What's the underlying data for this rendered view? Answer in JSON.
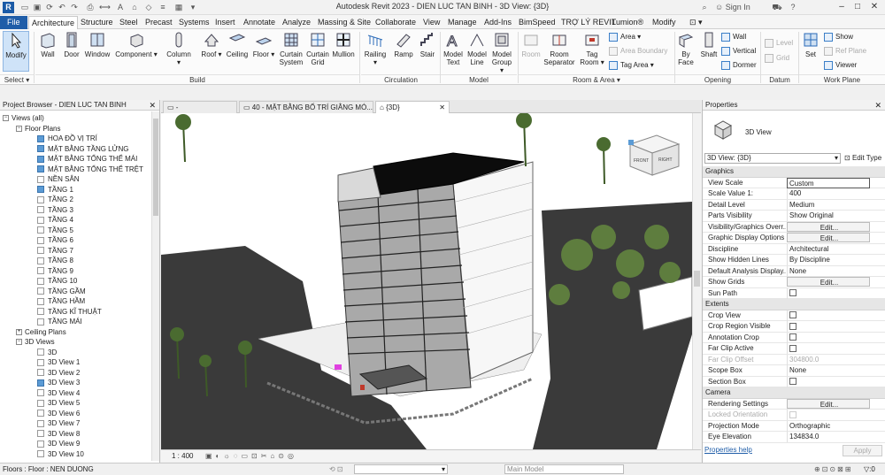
{
  "title_bar": {
    "title": "Autodesk Revit 2023 - DIEN LUC TAN BINH - 3D View: {3D}",
    "sign_in": "Sign In",
    "logo": "R"
  },
  "tabs": [
    "File",
    "Architecture",
    "Structure",
    "Steel",
    "Precast",
    "Systems",
    "Insert",
    "Annotate",
    "Analyze",
    "Massing & Site",
    "Collaborate",
    "View",
    "Manage",
    "Add-Ins",
    "BimSpeed",
    "TRỢ LÝ REVIT",
    "Lumion®",
    "Modify"
  ],
  "ribbon": {
    "select": {
      "modify": "Modify",
      "panel": "Select"
    },
    "build": {
      "wall": "Wall",
      "door": "Door",
      "window": "Window",
      "component": "Component",
      "column": "Column",
      "roof": "Roof",
      "ceiling": "Ceiling",
      "floor": "Floor",
      "curtain_system": "Curtain System",
      "curtain_grid": "Curtain Grid",
      "mullion": "Mullion",
      "panel": "Build"
    },
    "circulation": {
      "railing": "Railing",
      "ramp": "Ramp",
      "stair": "Stair",
      "panel": "Circulation"
    },
    "model": {
      "model_text": "Model Text",
      "model_line": "Model Line",
      "model_group": "Model Group",
      "panel": "Model"
    },
    "room_area": {
      "room": "Room",
      "room_separator": "Room Separator",
      "tag_room": "Tag Room",
      "area": "Area",
      "area_boundary": "Area Boundary",
      "tag_area": "Tag Area",
      "panel": "Room & Area"
    },
    "opening": {
      "by_face": "By Face",
      "shaft": "Shaft",
      "wall": "Wall",
      "vertical": "Vertical",
      "dormer": "Dormer",
      "panel": "Opening"
    },
    "datum": {
      "level": "Level",
      "grid": "Grid",
      "panel": "Datum"
    },
    "work_plane": {
      "set": "Set",
      "show": "Show",
      "ref_plane": "Ref Plane",
      "viewer": "Viewer",
      "panel": "Work Plane"
    }
  },
  "project_browser": {
    "header": "Project Browser - DIEN LUC TAN BINH",
    "views_all": "Views (all)",
    "floor_plans_label": "Floor Plans",
    "floor_plans": [
      {
        "name": "HOA ĐỒ VỊ TRÍ",
        "icon": "blue"
      },
      {
        "name": "MẶT BẰNG TẦNG LỬNG",
        "icon": "blue"
      },
      {
        "name": "MẶT BẰNG TỔNG THỂ MÁI",
        "icon": "blue"
      },
      {
        "name": "MẶT BẰNG TỔNG THỂ TRỆT",
        "icon": "blue"
      },
      {
        "name": "NỀN SÂN",
        "icon": "plain"
      },
      {
        "name": "TẦNG 1",
        "icon": "blue"
      },
      {
        "name": "TẦNG 2",
        "icon": "plain"
      },
      {
        "name": "TẦNG 3",
        "icon": "plain"
      },
      {
        "name": "TẦNG 4",
        "icon": "plain"
      },
      {
        "name": "TẦNG 5",
        "icon": "plain"
      },
      {
        "name": "TẦNG 6",
        "icon": "plain"
      },
      {
        "name": "TẦNG 7",
        "icon": "plain"
      },
      {
        "name": "TẦNG 8",
        "icon": "plain"
      },
      {
        "name": "TẦNG 9",
        "icon": "plain"
      },
      {
        "name": "TẦNG 10",
        "icon": "plain"
      },
      {
        "name": "TẦNG GẦM",
        "icon": "plain"
      },
      {
        "name": "TẦNG HẦM",
        "icon": "plain"
      },
      {
        "name": "TẦNG KĨ THUẬT",
        "icon": "plain"
      },
      {
        "name": "TẦNG MÁI",
        "icon": "plain"
      }
    ],
    "ceiling_plans_label": "Ceiling Plans",
    "views_3d_label": "3D Views",
    "views_3d": [
      {
        "name": "3D",
        "icon": "plain"
      },
      {
        "name": "3D View 1",
        "icon": "plain"
      },
      {
        "name": "3D View 2",
        "icon": "plain"
      },
      {
        "name": "3D View 3",
        "icon": "blue"
      },
      {
        "name": "3D View 4",
        "icon": "plain"
      },
      {
        "name": "3D View 5",
        "icon": "plain"
      },
      {
        "name": "3D View 6",
        "icon": "plain"
      },
      {
        "name": "3D View 7",
        "icon": "plain"
      },
      {
        "name": "3D View 8",
        "icon": "plain"
      },
      {
        "name": "3D View 9",
        "icon": "plain"
      },
      {
        "name": "3D View 10",
        "icon": "plain"
      }
    ]
  },
  "view_tabs": [
    {
      "label": "-"
    },
    {
      "label": "40 - MẶT BẰNG BỐ TRÍ GIẰNG MÓ..."
    },
    {
      "label": "{3D}"
    }
  ],
  "viewcube": {
    "front": "FRONT",
    "right": "RIGHT"
  },
  "view_control": {
    "scale": "1 : 400"
  },
  "properties": {
    "header": "Properties",
    "type_name": "3D View",
    "selector": "3D View: {3D}",
    "edit_type": "Edit Type",
    "sections": [
      {
        "name": "Graphics",
        "rows": [
          {
            "k": "View Scale",
            "v": "Custom",
            "t": "box"
          },
          {
            "k": "Scale Value    1:",
            "v": "400",
            "t": "text"
          },
          {
            "k": "Detail Level",
            "v": "Medium",
            "t": "text"
          },
          {
            "k": "Parts Visibility",
            "v": "Show Original",
            "t": "text"
          },
          {
            "k": "Visibility/Graphics Overr...",
            "v": "Edit...",
            "t": "btn"
          },
          {
            "k": "Graphic Display Options",
            "v": "Edit...",
            "t": "btn"
          },
          {
            "k": "Discipline",
            "v": "Architectural",
            "t": "text"
          },
          {
            "k": "Show Hidden Lines",
            "v": "By Discipline",
            "t": "text"
          },
          {
            "k": "Default Analysis Display...",
            "v": "None",
            "t": "text"
          },
          {
            "k": "Show Grids",
            "v": "Edit...",
            "t": "btn"
          },
          {
            "k": "Sun Path",
            "v": "",
            "t": "cb"
          }
        ]
      },
      {
        "name": "Extents",
        "rows": [
          {
            "k": "Crop View",
            "v": "",
            "t": "cb"
          },
          {
            "k": "Crop Region Visible",
            "v": "",
            "t": "cb"
          },
          {
            "k": "Annotation Crop",
            "v": "",
            "t": "cb"
          },
          {
            "k": "Far Clip Active",
            "v": "",
            "t": "cb"
          },
          {
            "k": "Far Clip Offset",
            "v": "304800.0",
            "t": "dis"
          },
          {
            "k": "Scope Box",
            "v": "None",
            "t": "text"
          },
          {
            "k": "Section Box",
            "v": "",
            "t": "cb"
          }
        ]
      },
      {
        "name": "Camera",
        "rows": [
          {
            "k": "Rendering Settings",
            "v": "Edit...",
            "t": "btn"
          },
          {
            "k": "Locked Orientation",
            "v": "",
            "t": "discb"
          },
          {
            "k": "Projection Mode",
            "v": "Orthographic",
            "t": "text"
          },
          {
            "k": "Eye Elevation",
            "v": "134834.0",
            "t": "text"
          }
        ]
      }
    ],
    "help": "Properties help",
    "apply": "Apply"
  },
  "status_bar": {
    "text": "Floors : Floor : NEN DUONG",
    "model": "Main Model",
    "zero": ":0"
  },
  "colors": {
    "accent": "#1f5da8",
    "selected_tool": "#cfe3f8",
    "road": "#3a3a3a"
  }
}
